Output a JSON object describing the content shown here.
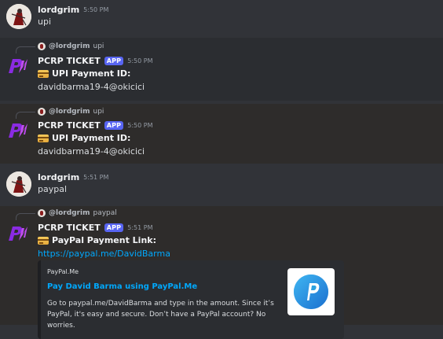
{
  "messages": [
    {
      "author": "lordgrim",
      "timestamp": "5:50 PM",
      "text": "upi"
    },
    {
      "reply_to_name": "@lordgrim",
      "reply_to_text": "upi",
      "author": "PCRP TICKET",
      "badge": "APP",
      "timestamp": "5:50 PM",
      "heading": "UPI Payment ID:",
      "text": "davidbarma19-4@okicici"
    },
    {
      "reply_to_name": "@lordgrim",
      "reply_to_text": "upi",
      "author": "PCRP TICKET",
      "badge": "APP",
      "timestamp": "5:50 PM",
      "heading": "UPI Payment ID:",
      "text": "davidbarma19-4@okicici"
    },
    {
      "author": "lordgrim",
      "timestamp": "5:51 PM",
      "text": "paypal"
    },
    {
      "reply_to_name": "@lordgrim",
      "reply_to_text": "paypal",
      "author": "PCRP TICKET",
      "badge": "APP",
      "timestamp": "5:51 PM",
      "heading": "PayPal Payment Link:",
      "link": "https://paypal.me/DavidBarma",
      "embed": {
        "provider": "PayPal.Me",
        "title": "Pay David Barma using PayPal.Me",
        "description": "Go to paypal.me/DavidBarma and type in the amount. Since it’s PayPal, it's easy and secure. Don’t have a PayPal account? No worries."
      }
    }
  ],
  "colors": {
    "background": "#313338",
    "app_badge": "#5865f2",
    "link": "#00a8fc",
    "bot_logo": "#8a2be2"
  },
  "icons": {
    "user_avatar": "lordgrim-avatar",
    "bot_avatar": "pcrp-logo",
    "credit_card": "credit-card-icon",
    "paypal_logo": "paypal-logo"
  }
}
